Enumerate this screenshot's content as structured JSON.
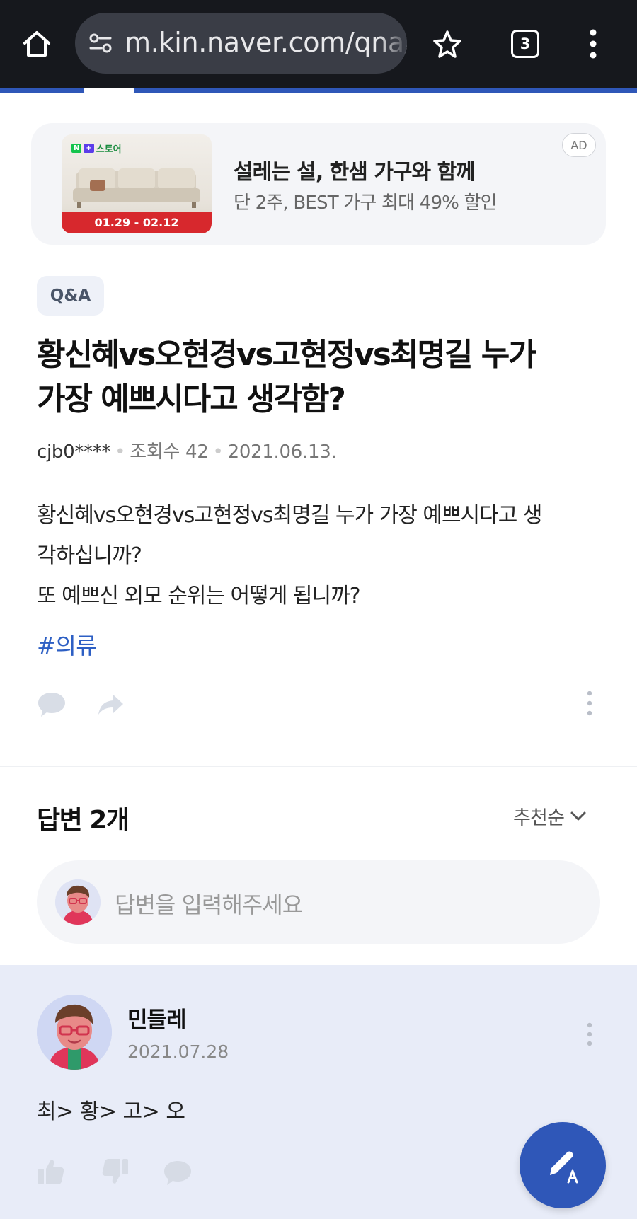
{
  "browser": {
    "url": "m.kin.naver.com/qna/d",
    "tab_count": "3",
    "icons": [
      "home-icon",
      "site-info-icon",
      "star-icon",
      "tabs-icon",
      "more-vert-icon"
    ]
  },
  "ad": {
    "thumb_brand": "스토어",
    "thumb_dates": "01.29 - 02.12",
    "title": "설레는 설, 한샘 가구와 함께",
    "subtitle": "단 2주, BEST 가구 최대 49% 할인",
    "badge": "AD"
  },
  "question": {
    "tag": "Q&A",
    "title_line1": "황신혜vs오현경vs고현정vs최명길 누가",
    "title_line2": "가장 예쁘시다고 생각함?",
    "author": "cjb0****",
    "views": "조회수 42",
    "date": "2021.06.13.",
    "body_line1": "황신혜vs오현경vs고현정vs최명길 누가 가장 예쁘시다고 생",
    "body_line2": "각하십니까?",
    "body_line3": "또 예쁘신 외모 순위는 어떻게 됩니까?",
    "hashtag": "#의류"
  },
  "answers": {
    "title": "답변 2개",
    "sort_label": "추천순",
    "input_placeholder": "답변을 입력해주세요"
  },
  "answer1": {
    "name": "민들레",
    "date": "2021.07.28",
    "text": "최> 황> 고> 오"
  },
  "colors": {
    "accent": "#2f57b8",
    "hashtag": "#2d5fc4",
    "answer_bg": "#e8ecf8",
    "browser_bg": "#16181d"
  }
}
